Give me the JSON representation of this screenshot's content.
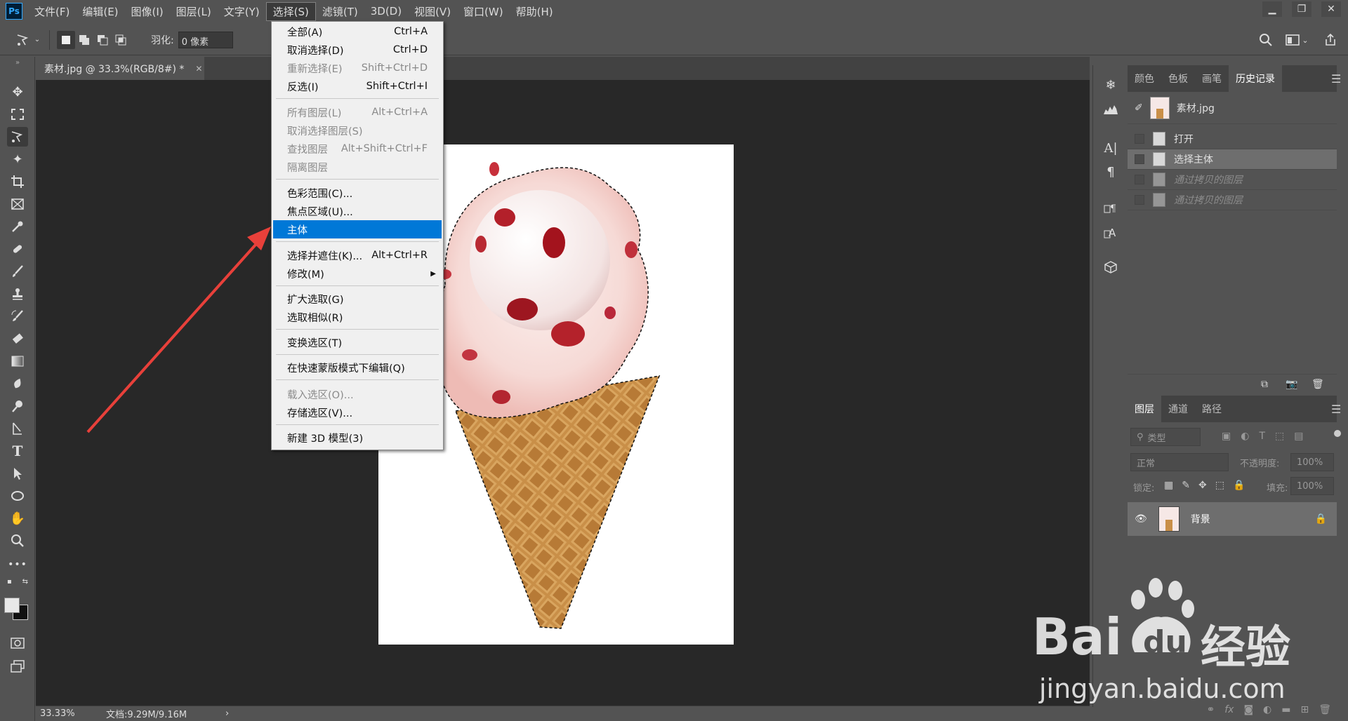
{
  "menubar": {
    "logo": "Ps",
    "items": [
      "文件(F)",
      "编辑(E)",
      "图像(I)",
      "图层(L)",
      "文字(Y)",
      "选择(S)",
      "滤镜(T)",
      "3D(D)",
      "视图(V)",
      "窗口(W)",
      "帮助(H)"
    ],
    "active_index": 5,
    "window_controls": [
      "▁",
      "❐",
      "✕"
    ]
  },
  "options": {
    "feather_label": "羽化:",
    "feather_value": "0 像素"
  },
  "document": {
    "tab_title": "素材.jpg @ 33.3%(RGB/8#) *",
    "close_glyph": "✕",
    "zoom": "33.33%",
    "doc_size": "文档:9.29M/9.16M",
    "status_arrow": "›"
  },
  "select_menu": {
    "items": [
      {
        "label": "全部(A)",
        "shortcut": "Ctrl+A",
        "disabled": false
      },
      {
        "label": "取消选择(D)",
        "shortcut": "Ctrl+D",
        "disabled": false
      },
      {
        "label": "重新选择(E)",
        "shortcut": "Shift+Ctrl+D",
        "disabled": true
      },
      {
        "label": "反选(I)",
        "shortcut": "Shift+Ctrl+I",
        "disabled": false
      },
      {
        "label": "所有图层(L)",
        "shortcut": "Alt+Ctrl+A",
        "disabled": true
      },
      {
        "label": "取消选择图层(S)",
        "shortcut": "",
        "disabled": true
      },
      {
        "label": "查找图层",
        "shortcut": "Alt+Shift+Ctrl+F",
        "disabled": true
      },
      {
        "label": "隔离图层",
        "shortcut": "",
        "disabled": true
      },
      {
        "label": "色彩范围(C)...",
        "shortcut": "",
        "disabled": false
      },
      {
        "label": "焦点区域(U)...",
        "shortcut": "",
        "disabled": false
      },
      {
        "label": "主体",
        "shortcut": "",
        "disabled": false,
        "highlighted": true
      },
      {
        "label": "选择并遮住(K)...",
        "shortcut": "Alt+Ctrl+R",
        "disabled": false
      },
      {
        "label": "修改(M)",
        "shortcut": "▶",
        "disabled": false
      },
      {
        "label": "扩大选取(G)",
        "shortcut": "",
        "disabled": false
      },
      {
        "label": "选取相似(R)",
        "shortcut": "",
        "disabled": false
      },
      {
        "label": "变换选区(T)",
        "shortcut": "",
        "disabled": false
      },
      {
        "label": "在快速蒙版模式下编辑(Q)",
        "shortcut": "",
        "disabled": false
      },
      {
        "label": "载入选区(O)...",
        "shortcut": "",
        "disabled": true
      },
      {
        "label": "存储选区(V)...",
        "shortcut": "",
        "disabled": false
      },
      {
        "label": "新建 3D 模型(3)",
        "shortcut": "",
        "disabled": false
      }
    ]
  },
  "history_panel": {
    "tabs": [
      "颜色",
      "色板",
      "画笔",
      "历史记录"
    ],
    "active_tab": 3,
    "snapshot_name": "素材.jpg",
    "states": [
      {
        "label": "打开",
        "state": "normal"
      },
      {
        "label": "选择主体",
        "state": "active"
      },
      {
        "label": "通过拷贝的图层",
        "state": "dim"
      },
      {
        "label": "通过拷贝的图层",
        "state": "dim"
      }
    ]
  },
  "layers_panel": {
    "tabs": [
      "图层",
      "通道",
      "路径"
    ],
    "active_tab": 0,
    "filter_placeholder": "类型",
    "blend_mode": "正常",
    "opacity_label": "不透明度:",
    "opacity_value": "100%",
    "lock_label": "锁定:",
    "fill_label": "填充:",
    "fill_value": "100%",
    "layers": [
      {
        "name": "背景",
        "visible": true,
        "locked": true
      }
    ],
    "footer_text": "fx"
  },
  "watermark": {
    "brand_left": "Bai",
    "brand_mid": "du",
    "brand_right": "经验",
    "url": "jingyan.baidu.com"
  },
  "colors": {
    "accent_highlight": "#0078d7",
    "arrow": "#e8403a"
  }
}
